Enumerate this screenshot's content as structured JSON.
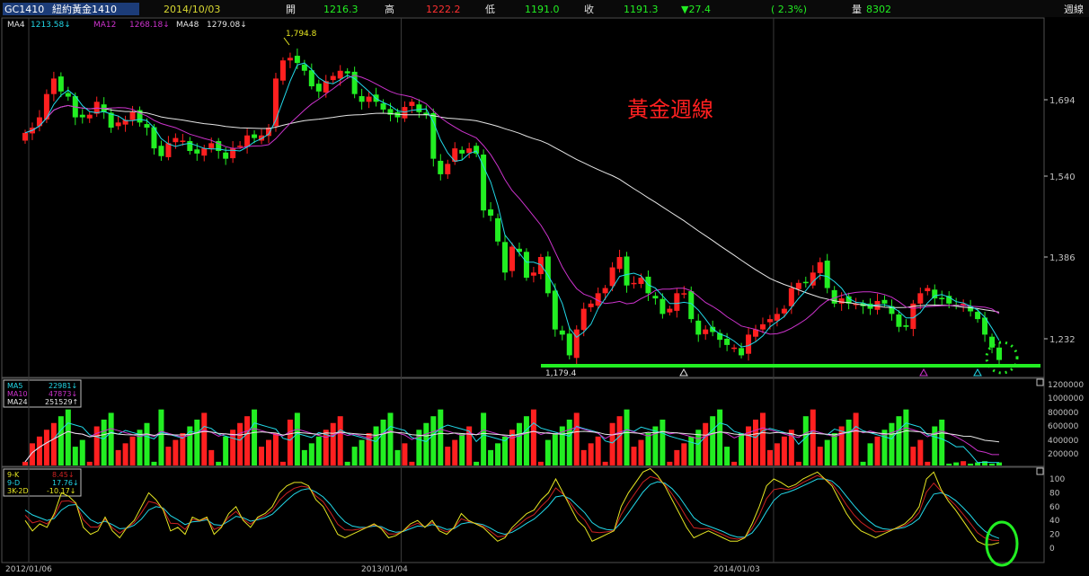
{
  "header": {
    "symbol": "GC1410",
    "name": "紐約黃金1410",
    "date": "2014/10/03",
    "open_label": "開",
    "open": "1216.3",
    "high_label": "高",
    "high": "1222.2",
    "low_label": "低",
    "low": "1191.0",
    "close_label": "收",
    "close": "1191.3",
    "change": "▼27.4",
    "change_pct": "( 2.3%)",
    "volume_label": "量",
    "volume": "8302",
    "period": "週線"
  },
  "price_legend": {
    "ma4": "MA4",
    "ma4_value": "1213.58↓",
    "ma12": "MA12",
    "ma12_value": "1268.18↓",
    "ma48": "MA48",
    "ma48_value": "1279.08↓"
  },
  "volume_legend": {
    "ma5": "MA5",
    "ma5_value": "22981↓",
    "ma10": "MA10",
    "ma10_value": "47873↓",
    "ma24": "MA24",
    "ma24_value": "251529↑"
  },
  "kd_legend": {
    "k": "9-K",
    "k_value": "8.45↓",
    "d": "9-D",
    "d_value": "17.76↓",
    "j": "3K-2D",
    "j_value": "-10.17↓"
  },
  "annotations": {
    "title_text": "黃金週線",
    "high_marker": "1,794.8",
    "low_marker": "1,179.4"
  },
  "colors": {
    "up": "#ff2020",
    "down": "#22ee22",
    "ma4": "#22d8e8",
    "ma12": "#cc33cc",
    "ma48": "#e6e6e6",
    "k": "#e6e622",
    "d": "#cc2222",
    "j": "#22d8e8",
    "support": "#22ee22",
    "axis": "#c0c0c0",
    "grid": "#3a3a3a"
  },
  "chart_data": [
    {
      "type": "candlestick",
      "title": "黃金週線",
      "x_ticks": [
        "2012/01/06",
        "2013/01/04",
        "2014/01/03"
      ],
      "y_ticks": [
        "1,232",
        "1,386",
        "1,540",
        "1,694"
      ],
      "ylim": [
        1150,
        1840
      ],
      "period": "weekly",
      "start": "2012/01/06",
      "series_close": [
        1630,
        1640,
        1660,
        1705,
        1735,
        1710,
        1700,
        1660,
        1660,
        1665,
        1690,
        1670,
        1640,
        1650,
        1655,
        1670,
        1650,
        1640,
        1600,
        1585,
        1610,
        1620,
        1615,
        1595,
        1590,
        1600,
        1610,
        1595,
        1580,
        1600,
        1605,
        1625,
        1620,
        1625,
        1640,
        1735,
        1770,
        1775,
        1765,
        1750,
        1720,
        1710,
        1730,
        1740,
        1750,
        1745,
        1705,
        1690,
        1700,
        1690,
        1675,
        1665,
        1660,
        1680,
        1690,
        1670,
        1665,
        1580,
        1550,
        1570,
        1600,
        1590,
        1600,
        1590,
        1480,
        1470,
        1420,
        1360,
        1410,
        1400,
        1350,
        1360,
        1390,
        1320,
        1250,
        1240,
        1200,
        1250,
        1290,
        1300,
        1320,
        1330,
        1370,
        1390,
        1335,
        1340,
        1350,
        1320,
        1310,
        1280,
        1290,
        1320,
        1320,
        1270,
        1240,
        1250,
        1245,
        1230,
        1220,
        1215,
        1200,
        1240,
        1250,
        1260,
        1270,
        1280,
        1290,
        1330,
        1340,
        1340,
        1360,
        1380,
        1330,
        1300,
        1310,
        1300,
        1300,
        1295,
        1290,
        1305,
        1300,
        1280,
        1255,
        1255,
        1300,
        1320,
        1330,
        1310,
        1310,
        1300,
        1295,
        1300,
        1285,
        1270,
        1240,
        1215,
        1191
      ],
      "k_series": [
        40,
        25,
        35,
        30,
        50,
        80,
        75,
        65,
        30,
        20,
        25,
        45,
        25,
        15,
        30,
        40,
        60,
        80,
        70,
        55,
        25,
        30,
        20,
        45,
        40,
        45,
        20,
        30,
        50,
        60,
        40,
        30,
        45,
        50,
        60,
        80,
        90,
        95,
        95,
        90,
        70,
        60,
        40,
        20,
        15,
        20,
        25,
        30,
        35,
        28,
        15,
        18,
        25,
        35,
        40,
        30,
        40,
        25,
        20,
        30,
        50,
        40,
        35,
        30,
        20,
        10,
        15,
        30,
        40,
        50,
        55,
        70,
        80,
        100,
        80,
        60,
        40,
        30,
        10,
        15,
        20,
        25,
        60,
        80,
        95,
        110,
        115,
        105,
        90,
        70,
        50,
        30,
        15,
        20,
        25,
        20,
        15,
        10,
        10,
        15,
        35,
        60,
        90,
        100,
        95,
        88,
        92,
        100,
        105,
        110,
        100,
        90,
        70,
        50,
        35,
        25,
        20,
        15,
        20,
        25,
        30,
        35,
        45,
        60,
        100,
        110,
        85,
        68,
        55,
        40,
        25,
        10,
        5,
        5,
        8
      ],
      "d_series": [
        55,
        48,
        44,
        40,
        43,
        55,
        62,
        63,
        52,
        41,
        36,
        39,
        34,
        28,
        29,
        33,
        42,
        55,
        60,
        58,
        47,
        41,
        34,
        38,
        39,
        41,
        34,
        33,
        39,
        46,
        44,
        39,
        41,
        44,
        49,
        59,
        69,
        78,
        84,
        86,
        81,
        74,
        63,
        49,
        38,
        32,
        30,
        30,
        32,
        31,
        26,
        23,
        24,
        28,
        32,
        31,
        34,
        31,
        27,
        28,
        35,
        37,
        36,
        34,
        29,
        23,
        20,
        23,
        29,
        36,
        42,
        51,
        61,
        74,
        76,
        71,
        61,
        51,
        37,
        30,
        27,
        26,
        37,
        51,
        66,
        81,
        92,
        96,
        94,
        86,
        74,
        59,
        44,
        36,
        32,
        28,
        24,
        19,
        16,
        16,
        22,
        35,
        53,
        69,
        78,
        81,
        85,
        90,
        95,
        100,
        100,
        97,
        88,
        75,
        62,
        50,
        40,
        32,
        28,
        27,
        28,
        30,
        35,
        43,
        62,
        78,
        80,
        76,
        69,
        59,
        48,
        35,
        25,
        18,
        14
      ]
    },
    {
      "type": "bar",
      "title": "",
      "y_ticks": [
        "200000",
        "400000",
        "600000",
        "800000",
        "1000000",
        "1200000"
      ],
      "ylim": [
        0,
        1300000
      ]
    }
  ]
}
